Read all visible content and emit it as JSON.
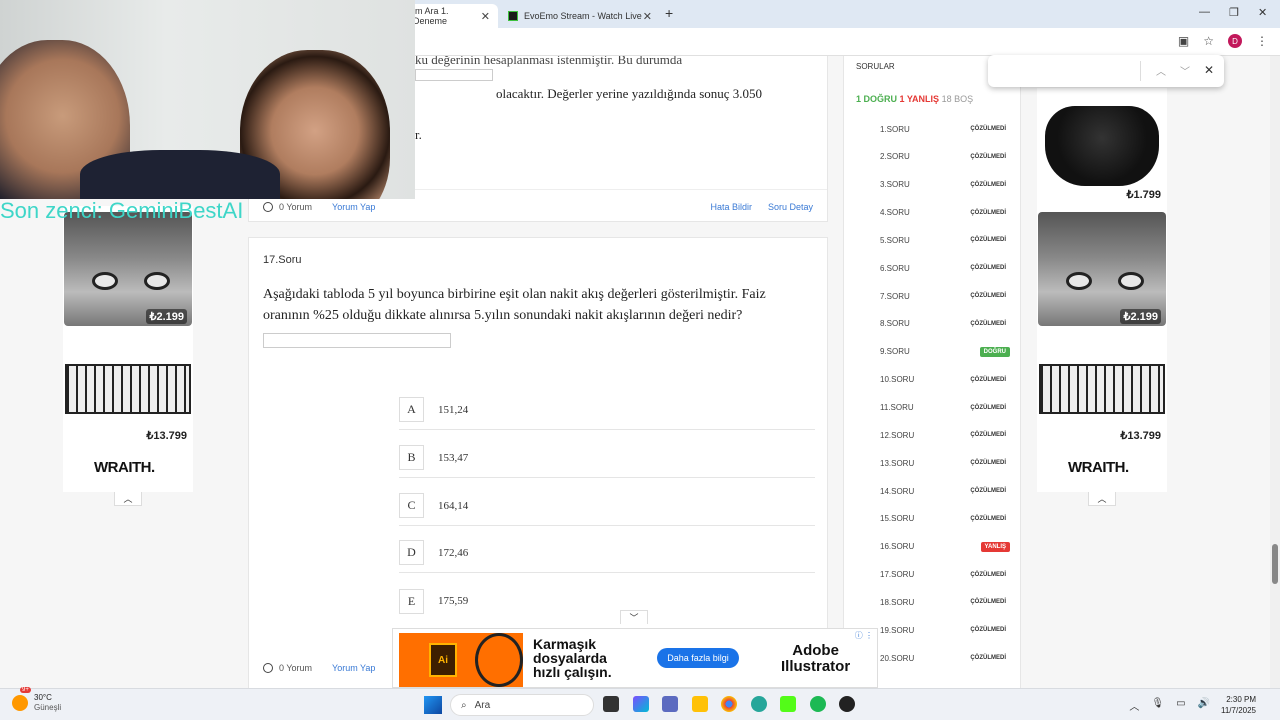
{
  "browser": {
    "tabs": [
      {
        "label": "im Ara 1. Deneme",
        "active": true
      },
      {
        "label": "EvoEmo Stream - Watch Live on",
        "active": false
      }
    ],
    "find_bar": {
      "value": ""
    }
  },
  "overlay": {
    "stream_caption": "Son zenci: GeminiBestAI"
  },
  "prev_question": {
    "line1_partial": "ku değerinin hesaplanması istenmiştir. Bu durumda",
    "line2": "olacaktır. Değerler yerine yazıldığında sonuç 3.050",
    "line3_partial": "r.",
    "comments": "0 Yorum",
    "comment_link": "Yorum Yap",
    "report_link": "Hata Bildir",
    "detail_link": "Soru Detay"
  },
  "question": {
    "number": "17.Soru",
    "text": "Aşağıdaki tabloda 5 yıl boyunca birbirine eşit olan nakit akış değerleri gösterilmiştir. Faiz oranının %25 olduğu dikkate alınırsa 5.yılın sonundaki nakit akışlarının değeri nedir?",
    "options": [
      {
        "letter": "A",
        "value": "151,24"
      },
      {
        "letter": "B",
        "value": "153,47"
      },
      {
        "letter": "C",
        "value": "164,14"
      },
      {
        "letter": "D",
        "value": "172,46"
      },
      {
        "letter": "E",
        "value": "175,59"
      }
    ],
    "comments": "0 Yorum",
    "comment_link": "Yorum Yap"
  },
  "sidebar": {
    "title": "SORULAR",
    "score_correct": "1 DOĞRU",
    "score_wrong": "1 YANLIŞ",
    "score_empty": "18 BOŞ",
    "items": [
      {
        "label": "1.SORU",
        "status": "ÇÖZÜLMEDİ"
      },
      {
        "label": "2.SORU",
        "status": "ÇÖZÜLMEDİ"
      },
      {
        "label": "3.SORU",
        "status": "ÇÖZÜLMEDİ"
      },
      {
        "label": "4.SORU",
        "status": "ÇÖZÜLMEDİ"
      },
      {
        "label": "5.SORU",
        "status": "ÇÖZÜLMEDİ"
      },
      {
        "label": "6.SORU",
        "status": "ÇÖZÜLMEDİ"
      },
      {
        "label": "7.SORU",
        "status": "ÇÖZÜLMEDİ"
      },
      {
        "label": "8.SORU",
        "status": "ÇÖZÜLMEDİ"
      },
      {
        "label": "9.SORU",
        "status": "DOĞRU"
      },
      {
        "label": "10.SORU",
        "status": "ÇÖZÜLMEDİ"
      },
      {
        "label": "11.SORU",
        "status": "ÇÖZÜLMEDİ"
      },
      {
        "label": "12.SORU",
        "status": "ÇÖZÜLMEDİ"
      },
      {
        "label": "13.SORU",
        "status": "ÇÖZÜLMEDİ"
      },
      {
        "label": "14.SORU",
        "status": "ÇÖZÜLMEDİ"
      },
      {
        "label": "15.SORU",
        "status": "ÇÖZÜLMEDİ"
      },
      {
        "label": "16.SORU",
        "status": "YANLIŞ"
      },
      {
        "label": "17.SORU",
        "status": "ÇÖZÜLMEDİ"
      },
      {
        "label": "18.SORU",
        "status": "ÇÖZÜLMEDİ"
      },
      {
        "label": "19.SORU",
        "status": "ÇÖZÜLMEDİ"
      },
      {
        "label": "20.SORU",
        "status": "ÇÖZÜLMEDİ"
      }
    ]
  },
  "ads": {
    "left": {
      "price1": "₺2.199",
      "price2": "₺13.799",
      "brand": "WRAITH."
    },
    "right": {
      "price0": "₺1.799",
      "price1": "₺2.199",
      "price2": "₺13.799",
      "brand": "WRAITH."
    },
    "bottom": {
      "tagline_1": "Karmaşık",
      "tagline_2": "dosyalarda",
      "tagline_3": "hızlı çalışın.",
      "cta": "Daha fazla bilgi",
      "brand_1": "Adobe",
      "brand_2": "Illustrator",
      "logo": "Ai"
    }
  },
  "taskbar": {
    "temp": "30°C",
    "weather": "Güneşli",
    "search_placeholder": "Ara",
    "time": "2:30 PM",
    "date": "11/7/2025",
    "notif_count": "9+"
  },
  "colors": {
    "correct": "#4caf50",
    "wrong": "#e53935",
    "link": "#3a7ad5",
    "caption": "#3ed6c8"
  }
}
